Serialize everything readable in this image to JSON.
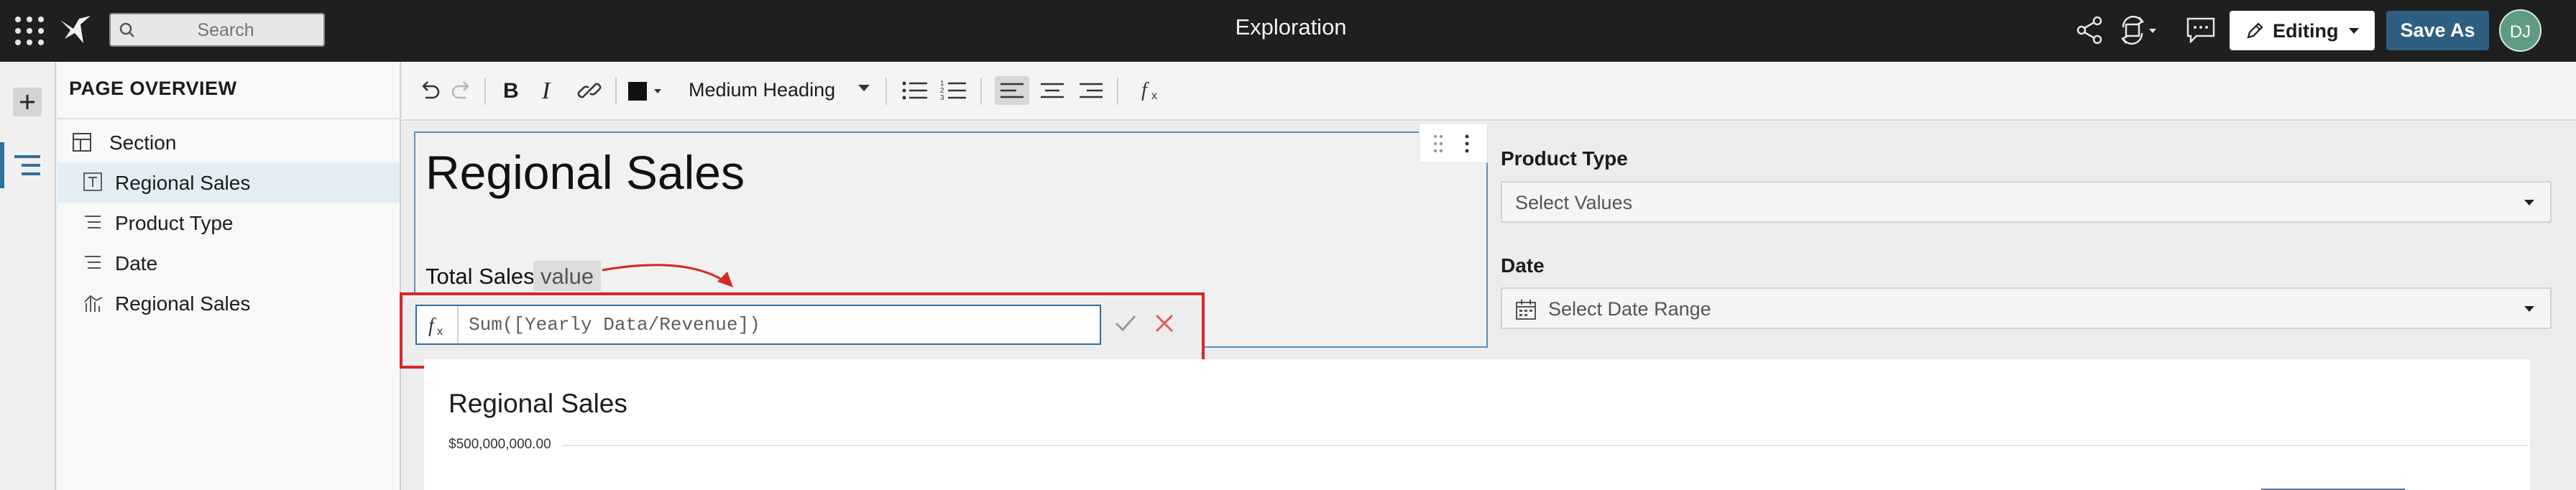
{
  "topbar": {
    "search_placeholder": "Search",
    "title": "Exploration",
    "editing_label": "Editing",
    "save_as_label": "Save As",
    "avatar_initials": "DJ"
  },
  "overview": {
    "heading": "PAGE OVERVIEW",
    "items": [
      {
        "label": "Section",
        "icon": "section-grid-icon",
        "selected": false
      },
      {
        "label": "Regional Sales",
        "icon": "text-element-icon",
        "selected": true
      },
      {
        "label": "Product Type",
        "icon": "list-control-icon",
        "selected": false
      },
      {
        "label": "Date",
        "icon": "list-control-icon",
        "selected": false
      },
      {
        "label": "Regional Sales",
        "icon": "chart-element-icon",
        "selected": false
      }
    ]
  },
  "toolbar": {
    "heading_style": "Medium Heading"
  },
  "text_element": {
    "heading": "Regional Sales",
    "body_label": "Total Sales",
    "value_chip": "value"
  },
  "formula": {
    "expression": "Sum([Yearly Data/Revenue])"
  },
  "controls": {
    "product_type": {
      "label": "Product Type",
      "placeholder": "Select Values"
    },
    "date": {
      "label": "Date",
      "placeholder": "Select Date Range"
    }
  },
  "chart": {
    "title": "Regional Sales",
    "top_tick": "$500,000,000.00"
  },
  "chart_data": {
    "type": "bar",
    "title": "Regional Sales",
    "yticks": [
      "$500,000,000.00"
    ],
    "ylim": [
      0,
      500000000
    ],
    "visible_bar_top_fraction_below_max": 0.29
  },
  "colors": {
    "topbar_bg": "#1f1f1f",
    "accent": "#2e6f9e",
    "save_button": "#2e5f80",
    "highlight_outline": "#d62727",
    "bar": "#5e7593"
  }
}
